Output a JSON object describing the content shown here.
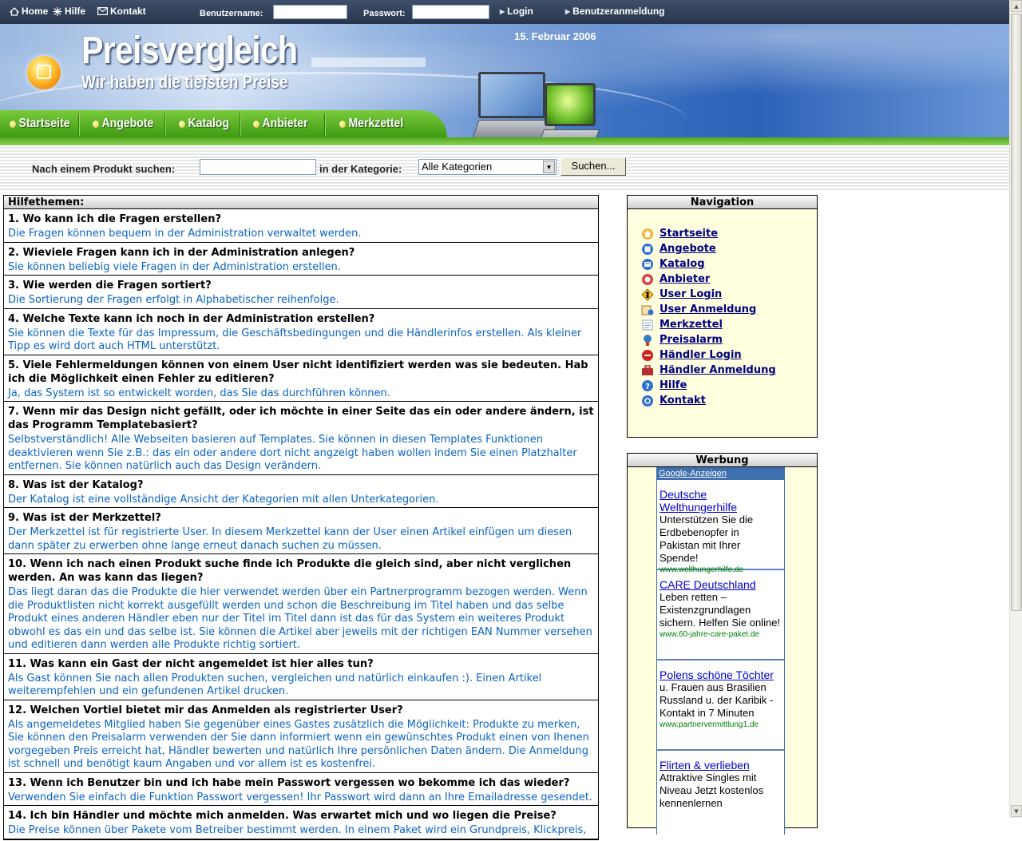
{
  "topbar": {
    "home": "Home",
    "help": "Hilfe",
    "contact": "Kontakt",
    "username_label": "Benutzername:",
    "password_label": "Passwort:",
    "login": "Login",
    "register": "Benutzeranmeldung"
  },
  "header": {
    "title": "Preisvergleich",
    "subtitle": "Wir haben die tiefsten Preise",
    "date": "15. Februar 2006",
    "nav": [
      "Startseite",
      "Angebote",
      "Katalog",
      "Anbieter",
      "Merkzettel"
    ]
  },
  "search": {
    "label": "Nach einem Produkt suchen:",
    "category_label": "in der Kategorie:",
    "category_value": "Alle Kategorien",
    "button": "Suchen..."
  },
  "help": {
    "heading": "Hilfethemen:",
    "faqs": [
      {
        "q": "1. Wo kann ich die Fragen erstellen?",
        "a": "Die Fragen können bequem in der Administration verwaltet werden."
      },
      {
        "q": "2. Wieviele Fragen kann ich in der Administration anlegen?",
        "a": "Sie können beliebig viele Fragen in der Administration erstellen."
      },
      {
        "q": "3. Wie werden die Fragen sortiert?",
        "a": "Die Sortierung der Fragen erfolgt in Alphabetischer reihenfolge."
      },
      {
        "q": "4. Welche Texte kann ich noch in der Administration erstellen?",
        "a": "Sie können die Texte für das Impressum, die Geschäftsbedingungen und die Händlerinfos erstellen. Als kleiner Tipp es wird dort auch HTML unterstützt."
      },
      {
        "q": "5. Viele Fehlermeldungen können von einem User nicht identifiziert werden was sie bedeuten. Hab ich die Möglichkeit einen Fehler zu editieren?",
        "a": "Ja, das System ist so entwickelt worden, das Sie das durchführen können."
      },
      {
        "q": "7. Wenn mir das Design nicht gefällt, oder ich möchte in einer Seite das ein oder andere ändern, ist das Programm Templatebasiert?",
        "a": "Selbstverständlich! Alle Webseiten basieren auf Templates. Sie können in diesen Templates Funktionen deaktivieren wenn Sie z.B.: das ein oder andere dort nicht angzeigt haben wollen indem Sie einen Platzhalter entfernen. Sie können natürlich auch das Design verändern."
      },
      {
        "q": "8. Was ist der Katalog?",
        "a": "Der Katalog ist eine vollständige Ansicht der Kategorien mit allen Unterkategorien."
      },
      {
        "q": "9. Was ist der Merkzettel?",
        "a": "Der Merkzettel ist für registrierte User. In diesem Merkzettel kann der User einen Artikel einfügen um diesen dann später zu erwerben ohne lange erneut danach suchen zu müssen."
      },
      {
        "q": "10. Wenn ich nach einen Produkt suche finde ich Produkte die gleich sind, aber nicht verglichen werden. An was kann das liegen?",
        "a": "Das liegt daran das die Produkte die hier verwendet werden über ein Partnerprogramm bezogen werden. Wenn die Produktlisten nicht korrekt ausgefüllt werden und schon die Beschreibung im Titel haben und das selbe Produkt eines anderen Händler eben nur der Titel im Titel dann ist das für das System ein weiteres Produkt obwohl es das ein und das selbe ist. Sie können die Artikel aber jeweils mit der richtigen EAN Nummer versehen und editieren dann werden alle Produkte richtig sortiert."
      },
      {
        "q": "11. Was kann ein Gast der nicht angemeldet ist hier alles tun?",
        "a": "Als Gast können Sie nach allen Produkten suchen, vergleichen und natürlich einkaufen :). Einen Artikel weiterempfehlen und ein gefundenen Artikel drucken."
      },
      {
        "q": "12. Welchen Vortiel bietet mir das Anmelden als registrierter User?",
        "a": "Als angemeldetes Mitglied haben Sie gegenüber eines Gastes zusätzlich die Möglichkeit: Produkte zu merken, Sie können den Preisalarm verwenden der Sie dann informiert wenn ein gewünschtes Produkt einen von Ihenen vorgegeben Preis erreicht hat, Händler bewerten und natürlich Ihre persönlichen Daten ändern. Die Anmeldung ist schnell und benötigt kaum Angaben und vor allem ist es kostenfrei."
      },
      {
        "q": "13. Wenn ich Benutzer bin und ich habe mein Passwort vergessen wo bekomme ich das wieder?",
        "a": "Verwenden Sie einfach die Funktion Passwort vergessen! Ihr Passwort wird dann an Ihre Emailadresse gesendet."
      },
      {
        "q": "14. Ich bin Händler und möchte mich anmelden. Was erwartet mich und wo liegen die Preise?",
        "a": "Die Preise können über Pakete vom Betreiber bestimmt werden. In einem Paket wird ein Grundpreis, Klickpreis,"
      }
    ]
  },
  "navigation": {
    "heading": "Navigation",
    "items": [
      {
        "label": "Startseite",
        "icon": "home-icon",
        "color": "#f0a020"
      },
      {
        "label": "Angebote",
        "icon": "offers-icon",
        "color": "#2f6fd0"
      },
      {
        "label": "Katalog",
        "icon": "catalog-icon",
        "color": "#2f6fd0"
      },
      {
        "label": "Anbieter",
        "icon": "vendor-icon",
        "color": "#e04040"
      },
      {
        "label": "User Login",
        "icon": "user-login-icon",
        "color": "#e0a000"
      },
      {
        "label": "User Anmeldung",
        "icon": "user-register-icon",
        "color": "#c08a30"
      },
      {
        "label": "Merkzettel",
        "icon": "notepad-icon",
        "color": "#8aa0c0"
      },
      {
        "label": "Preisalarm",
        "icon": "price-alarm-icon",
        "color": "#3a78c8"
      },
      {
        "label": "Händler Login",
        "icon": "dealer-login-icon",
        "color": "#d02020"
      },
      {
        "label": "Händler Anmeldung",
        "icon": "dealer-register-icon",
        "color": "#b03030"
      },
      {
        "label": "Hilfe",
        "icon": "help-icon",
        "color": "#3070d0"
      },
      {
        "label": "Kontakt",
        "icon": "contact-icon",
        "color": "#3070d0"
      }
    ]
  },
  "ads": {
    "heading": "Werbung",
    "google_label": "Google-Anzeigen",
    "items": [
      {
        "title": "Deutsche Welthungerhilfe",
        "body": "Unterstützen Sie die Erdbebenopfer in Pakistan mit Ihrer Spende!",
        "url": "www.welthungerhilfe.de"
      },
      {
        "title": "CARE Deutschland",
        "body": "Leben retten – Existenzgrundlagen sichern. Helfen Sie online!",
        "url": "www.60-jahre-care-paket.de"
      },
      {
        "title": "Polens schöne Töchter",
        "body": "u. Frauen aus Brasilien Russland u. der Karibik - Kontakt in 7 Minuten",
        "url": "www.partnervermittlung1.de"
      },
      {
        "title": "Flirten & verlieben",
        "body": "Attraktive Singles mit Niveau Jetzt kostenlos kennenlernen",
        "url": ""
      }
    ]
  }
}
